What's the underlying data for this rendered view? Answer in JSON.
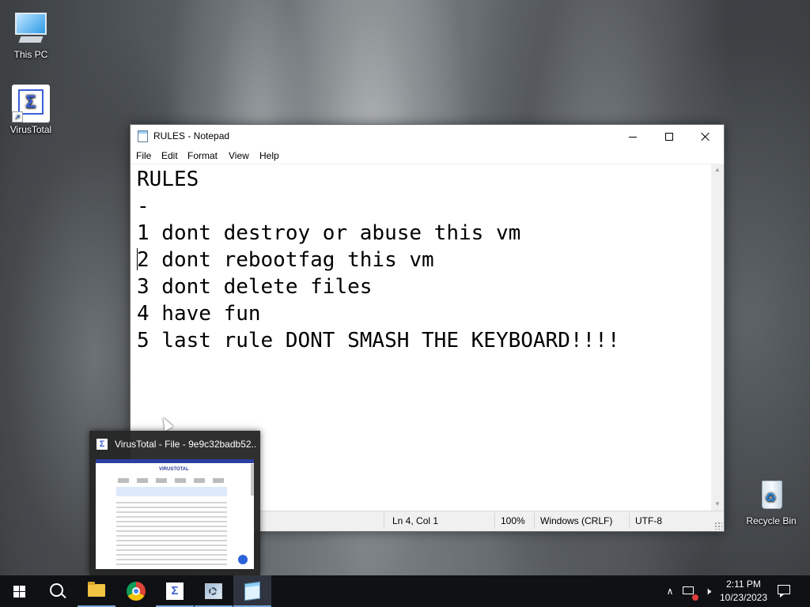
{
  "desktop": {
    "icons": [
      {
        "label": "This PC",
        "icon": "computer-icon"
      },
      {
        "label": "VirusTotal",
        "icon": "virustotal-icon"
      },
      {
        "label": "Recycle Bin",
        "icon": "recycle-bin-icon"
      }
    ]
  },
  "notepad": {
    "title": "RULES - Notepad",
    "menu": [
      "File",
      "Edit",
      "Format",
      "View",
      "Help"
    ],
    "lines": [
      "RULES",
      "-",
      "1 dont destroy or abuse this vm",
      "2 dont rebootfag this vm",
      "3 dont delete files",
      "4 have fun",
      "5 last rule DONT SMASH THE KEYBOARD!!!!"
    ],
    "status": {
      "position": "Ln 4, Col 1",
      "zoom": "100%",
      "line_ending": "Windows (CRLF)",
      "encoding": "UTF-8"
    }
  },
  "thumbnail": {
    "title": "VirusTotal - File - 9e9c32badb52...",
    "preview_logo": "VIRUSTOTAL"
  },
  "taskbar": {
    "items": [
      {
        "name": "start",
        "icon": "windows-logo-icon"
      },
      {
        "name": "search",
        "icon": "search-icon"
      },
      {
        "name": "file-explorer",
        "icon": "folder-icon"
      },
      {
        "name": "chrome",
        "icon": "chrome-icon"
      },
      {
        "name": "virustotal",
        "icon": "virustotal-icon"
      },
      {
        "name": "installer",
        "icon": "installer-icon"
      },
      {
        "name": "notepad",
        "icon": "notepad-icon"
      }
    ],
    "clock": {
      "time": "2:11 PM",
      "date": "10/23/2023"
    }
  },
  "colors": {
    "taskbar_bg": "#0f1115",
    "accent": "#3a5fd6",
    "active_indicator": "#7aa7d9"
  }
}
